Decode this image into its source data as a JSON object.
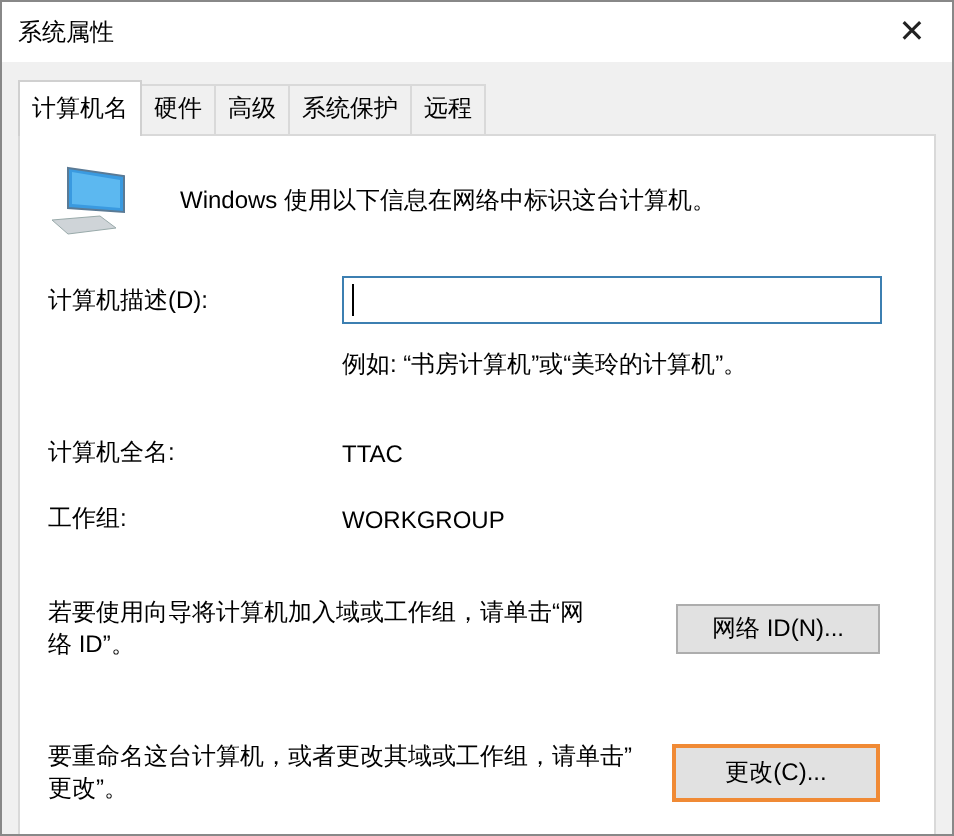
{
  "window": {
    "title": "系统属性",
    "close": "✕"
  },
  "tabs": [
    {
      "label": "计算机名",
      "selected": true
    },
    {
      "label": "硬件",
      "selected": false
    },
    {
      "label": "高级",
      "selected": false
    },
    {
      "label": "系统保护",
      "selected": false
    },
    {
      "label": "远程",
      "selected": false
    }
  ],
  "intro": "Windows 使用以下信息在网络中标识这台计算机。",
  "description": {
    "label": "计算机描述(D):",
    "focused": true,
    "hint": "例如: “书房计算机”或“美玲的计算机”。"
  },
  "info_rows": [
    {
      "label": "计算机全名:",
      "value": "TTAC"
    },
    {
      "label": "工作组:",
      "value": "WORKGROUP"
    }
  ],
  "actions": [
    {
      "lines": [
        "若要使用向导将计算机加入域或工作组，请单击“网",
        "络 ID”。"
      ],
      "button": "网络 ID(N)...",
      "highlighted": false
    },
    {
      "lines": [
        "要重命名这台计算机，或者更改其域或工作组，请单击”",
        "更改”。"
      ],
      "button": "更改(C)...",
      "highlighted": true
    }
  ]
}
